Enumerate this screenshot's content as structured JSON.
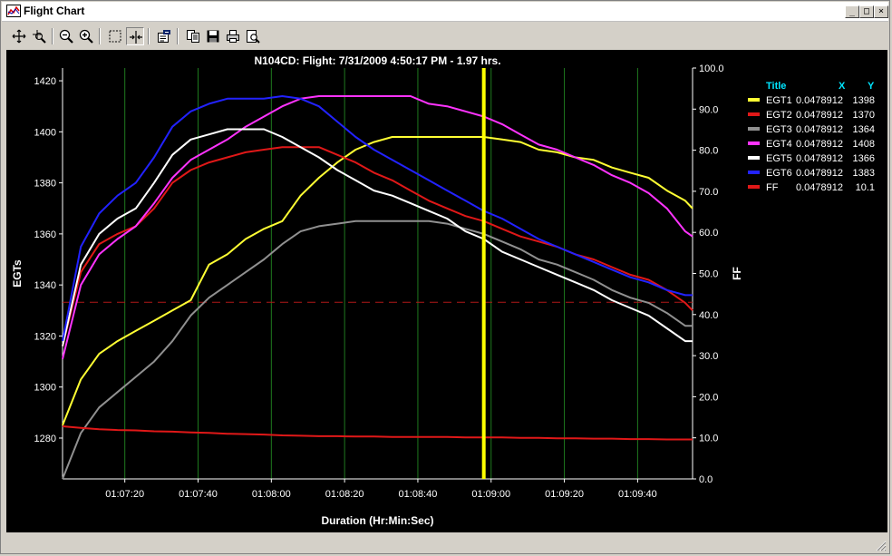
{
  "window": {
    "title": "Flight Chart",
    "minimize_glyph": "_",
    "maximize_glyph": "□",
    "close_glyph": "×"
  },
  "toolbar": {
    "buttons": [
      {
        "id": "pan",
        "icon": "pan-icon"
      },
      {
        "id": "zoom-box",
        "icon": "zoom-box-icon"
      },
      {
        "id": "zoom-out",
        "icon": "zoom-out-icon"
      },
      {
        "id": "zoom-in",
        "icon": "zoom-in-icon"
      },
      {
        "id": "select",
        "icon": "select-box-icon"
      },
      {
        "id": "cursor",
        "icon": "cursor-line-icon",
        "pressed": true
      },
      {
        "id": "properties",
        "icon": "properties-icon"
      },
      {
        "id": "copy",
        "icon": "copy-icon"
      },
      {
        "id": "save",
        "icon": "save-icon"
      },
      {
        "id": "print",
        "icon": "print-icon"
      },
      {
        "id": "print-preview",
        "icon": "print-preview-icon"
      }
    ]
  },
  "colors": {
    "background": "#000000",
    "grid": "#1f7a1f",
    "cursor": "#ffff00",
    "axis_text": "#ffffff",
    "legend_header": "#00e5ff"
  },
  "chart_data": {
    "type": "line",
    "title": "N104CD:  Flight: 7/31/2009 4:50:17 PM - 1.97 hrs.",
    "xlabel": "Duration (Hr:Min:Sec)",
    "ylabel": "EGTs",
    "y2label": "FF",
    "xlim_seconds": [
      4023,
      4195
    ],
    "xlim": [
      "01:07:03",
      "01:09:55"
    ],
    "ylim": [
      1264,
      1425
    ],
    "y2lim": [
      0,
      100
    ],
    "x_ticks": [
      "01:07:20",
      "01:07:40",
      "01:08:00",
      "01:08:20",
      "01:08:40",
      "01:09:00",
      "01:09:20",
      "01:09:40"
    ],
    "y_ticks": [
      1280,
      1300,
      1320,
      1340,
      1360,
      1380,
      1400,
      1420
    ],
    "y2_ticks": [
      "0.0",
      "10.0",
      "20.0",
      "30.0",
      "40.0",
      "50.0",
      "60.0",
      "70.0",
      "80.0",
      "90.0",
      "100.0"
    ],
    "grid": "vertical",
    "cursor_x": "01:08:58",
    "reference_line": {
      "axis": "y2",
      "value": 43,
      "color": "#b01818"
    },
    "legend": {
      "position": "right",
      "header": {
        "title": "Title",
        "x": "X",
        "y": "Y"
      },
      "entries": [
        {
          "name": "EGT1",
          "x": "0.0478912",
          "y": "1398",
          "color": "#ffff33"
        },
        {
          "name": "EGT2",
          "x": "0.0478912",
          "y": "1370",
          "color": "#e01818"
        },
        {
          "name": "EGT3",
          "x": "0.0478912",
          "y": "1364",
          "color": "#909090"
        },
        {
          "name": "EGT4",
          "x": "0.0478912",
          "y": "1408",
          "color": "#ff33ff"
        },
        {
          "name": "EGT5",
          "x": "0.0478912",
          "y": "1366",
          "color": "#ffffff"
        },
        {
          "name": "EGT6",
          "x": "0.0478912",
          "y": "1383",
          "color": "#2222ff"
        },
        {
          "name": "FF",
          "x": "0.0478912",
          "y": "10.1",
          "color": "#e01818"
        }
      ]
    },
    "x": [
      4023,
      4028,
      4033,
      4038,
      4043,
      4048,
      4053,
      4058,
      4063,
      4068,
      4073,
      4078,
      4083,
      4088,
      4093,
      4098,
      4103,
      4108,
      4113,
      4118,
      4123,
      4128,
      4133,
      4138,
      4143,
      4148,
      4153,
      4158,
      4163,
      4168,
      4173,
      4178,
      4183,
      4188,
      4193,
      4195
    ],
    "series": [
      {
        "name": "EGT1",
        "axis": "y",
        "color": "#ffff33",
        "values": [
          1285,
          1303,
          1313,
          1318,
          1322,
          1326,
          1330,
          1334,
          1348,
          1352,
          1358,
          1362,
          1365,
          1375,
          1382,
          1388,
          1393,
          1396,
          1398,
          1398,
          1398,
          1398,
          1398,
          1398,
          1397,
          1396,
          1393,
          1392,
          1390,
          1389,
          1386,
          1384,
          1382,
          1377,
          1373,
          1370
        ]
      },
      {
        "name": "EGT2",
        "axis": "y",
        "color": "#e01818",
        "values": [
          1316,
          1345,
          1356,
          1360,
          1363,
          1370,
          1380,
          1385,
          1388,
          1390,
          1392,
          1393,
          1394,
          1394,
          1394,
          1391,
          1388,
          1384,
          1381,
          1377,
          1373,
          1370,
          1367,
          1365,
          1362,
          1359,
          1357,
          1355,
          1352,
          1350,
          1347,
          1344,
          1342,
          1338,
          1333,
          1330
        ]
      },
      {
        "name": "EGT3",
        "axis": "y",
        "color": "#909090",
        "values": [
          1264,
          1282,
          1292,
          1298,
          1304,
          1310,
          1318,
          1328,
          1335,
          1340,
          1345,
          1350,
          1356,
          1361,
          1363,
          1364,
          1365,
          1365,
          1365,
          1365,
          1365,
          1364,
          1362,
          1360,
          1357,
          1354,
          1350,
          1348,
          1345,
          1342,
          1338,
          1335,
          1333,
          1329,
          1324,
          1324
        ]
      },
      {
        "name": "EGT4",
        "axis": "y",
        "color": "#ff33ff",
        "values": [
          1311,
          1340,
          1352,
          1358,
          1363,
          1372,
          1382,
          1389,
          1393,
          1397,
          1402,
          1406,
          1410,
          1413,
          1414,
          1414,
          1414,
          1414,
          1414,
          1414,
          1411,
          1410,
          1408,
          1406,
          1403,
          1399,
          1395,
          1393,
          1390,
          1387,
          1383,
          1380,
          1376,
          1370,
          1361,
          1359
        ]
      },
      {
        "name": "EGT5",
        "axis": "y",
        "color": "#ffffff",
        "values": [
          1316,
          1348,
          1360,
          1366,
          1370,
          1380,
          1391,
          1397,
          1399,
          1401,
          1401,
          1401,
          1398,
          1394,
          1390,
          1385,
          1381,
          1377,
          1375,
          1372,
          1369,
          1366,
          1361,
          1358,
          1353,
          1350,
          1347,
          1344,
          1341,
          1338,
          1334,
          1331,
          1328,
          1323,
          1318,
          1318
        ]
      },
      {
        "name": "EGT6",
        "axis": "y",
        "color": "#2222ff",
        "values": [
          1318,
          1355,
          1368,
          1375,
          1380,
          1390,
          1402,
          1408,
          1411,
          1413,
          1413,
          1413,
          1414,
          1413,
          1410,
          1404,
          1398,
          1393,
          1389,
          1385,
          1381,
          1377,
          1373,
          1369,
          1366,
          1362,
          1358,
          1355,
          1352,
          1349,
          1346,
          1343,
          1341,
          1338,
          1336,
          1336
        ]
      },
      {
        "name": "FF",
        "axis": "y2",
        "color": "#e01818",
        "values": [
          12.8,
          12.4,
          12.1,
          11.9,
          11.8,
          11.6,
          11.5,
          11.3,
          11.2,
          11.0,
          10.9,
          10.8,
          10.6,
          10.5,
          10.4,
          10.4,
          10.3,
          10.3,
          10.2,
          10.2,
          10.2,
          10.2,
          10.1,
          10.1,
          10.1,
          10.0,
          10.0,
          9.9,
          9.9,
          9.8,
          9.8,
          9.7,
          9.7,
          9.6,
          9.6,
          9.6
        ]
      }
    ]
  }
}
